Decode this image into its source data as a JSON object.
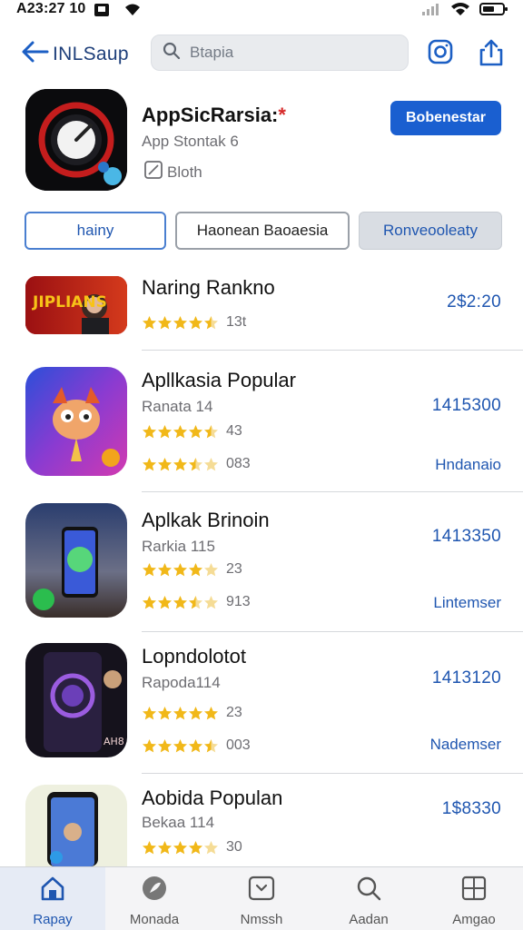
{
  "status_bar": {
    "time": "A23:27 10"
  },
  "nav": {
    "back_label": "INLSaup",
    "search_placeholder": "Btapia"
  },
  "app": {
    "name": "AppSicRarsia:",
    "name_mark": "*",
    "subtitle": "App Stontak 6",
    "meta": "Bloth",
    "get_label": "Bobenestar"
  },
  "tabs": [
    {
      "label": "hainy"
    },
    {
      "label": "Haonean Baoaesia"
    },
    {
      "label": "Ronveooleaty"
    }
  ],
  "rows": [
    {
      "title": "Naring Rankno",
      "sub": "",
      "rating1": 4.5,
      "count1": "13t",
      "rating2": null,
      "count2": "",
      "value": "2$2:20",
      "action": "",
      "icon_text": "JIPLIANS"
    },
    {
      "title": "Apllkasia Popular",
      "sub": "Ranata 14",
      "rating1": 4.5,
      "count1": "43",
      "rating2": 3.5,
      "count2": "083",
      "value": "1415300",
      "action": "Hndanaio",
      "icon_text": ""
    },
    {
      "title": "Aplkak Brinoin",
      "sub": "Rarkia 115",
      "rating1": 4,
      "count1": "23",
      "rating2": 3.5,
      "count2": "913",
      "value": "1413350",
      "action": "Lintemser",
      "icon_text": ""
    },
    {
      "title": "Lopndolotot",
      "sub": "Rapoda114",
      "rating1": 5,
      "count1": "23",
      "rating2": 4.5,
      "count2": "003",
      "value": "1413120",
      "action": "Nademser",
      "icon_text": "AH8"
    },
    {
      "title": "Aobida Populan",
      "sub": "Bekaa 114",
      "rating1": 4,
      "count1": "30",
      "rating2": null,
      "count2": "",
      "value": "1$8330",
      "action": "",
      "icon_text": ""
    }
  ],
  "tab_bar": [
    {
      "label": "Rapay",
      "icon": "home-icon"
    },
    {
      "label": "Monada",
      "icon": "leaf-icon"
    },
    {
      "label": "Nmssh",
      "icon": "message-icon"
    },
    {
      "label": "Aadan",
      "icon": "search-icon"
    },
    {
      "label": "Amgao",
      "icon": "apps-icon"
    }
  ],
  "colors": {
    "accent": "#1a5fd0",
    "star_full": "#f1b819",
    "star_empty": "#f5dc96"
  }
}
